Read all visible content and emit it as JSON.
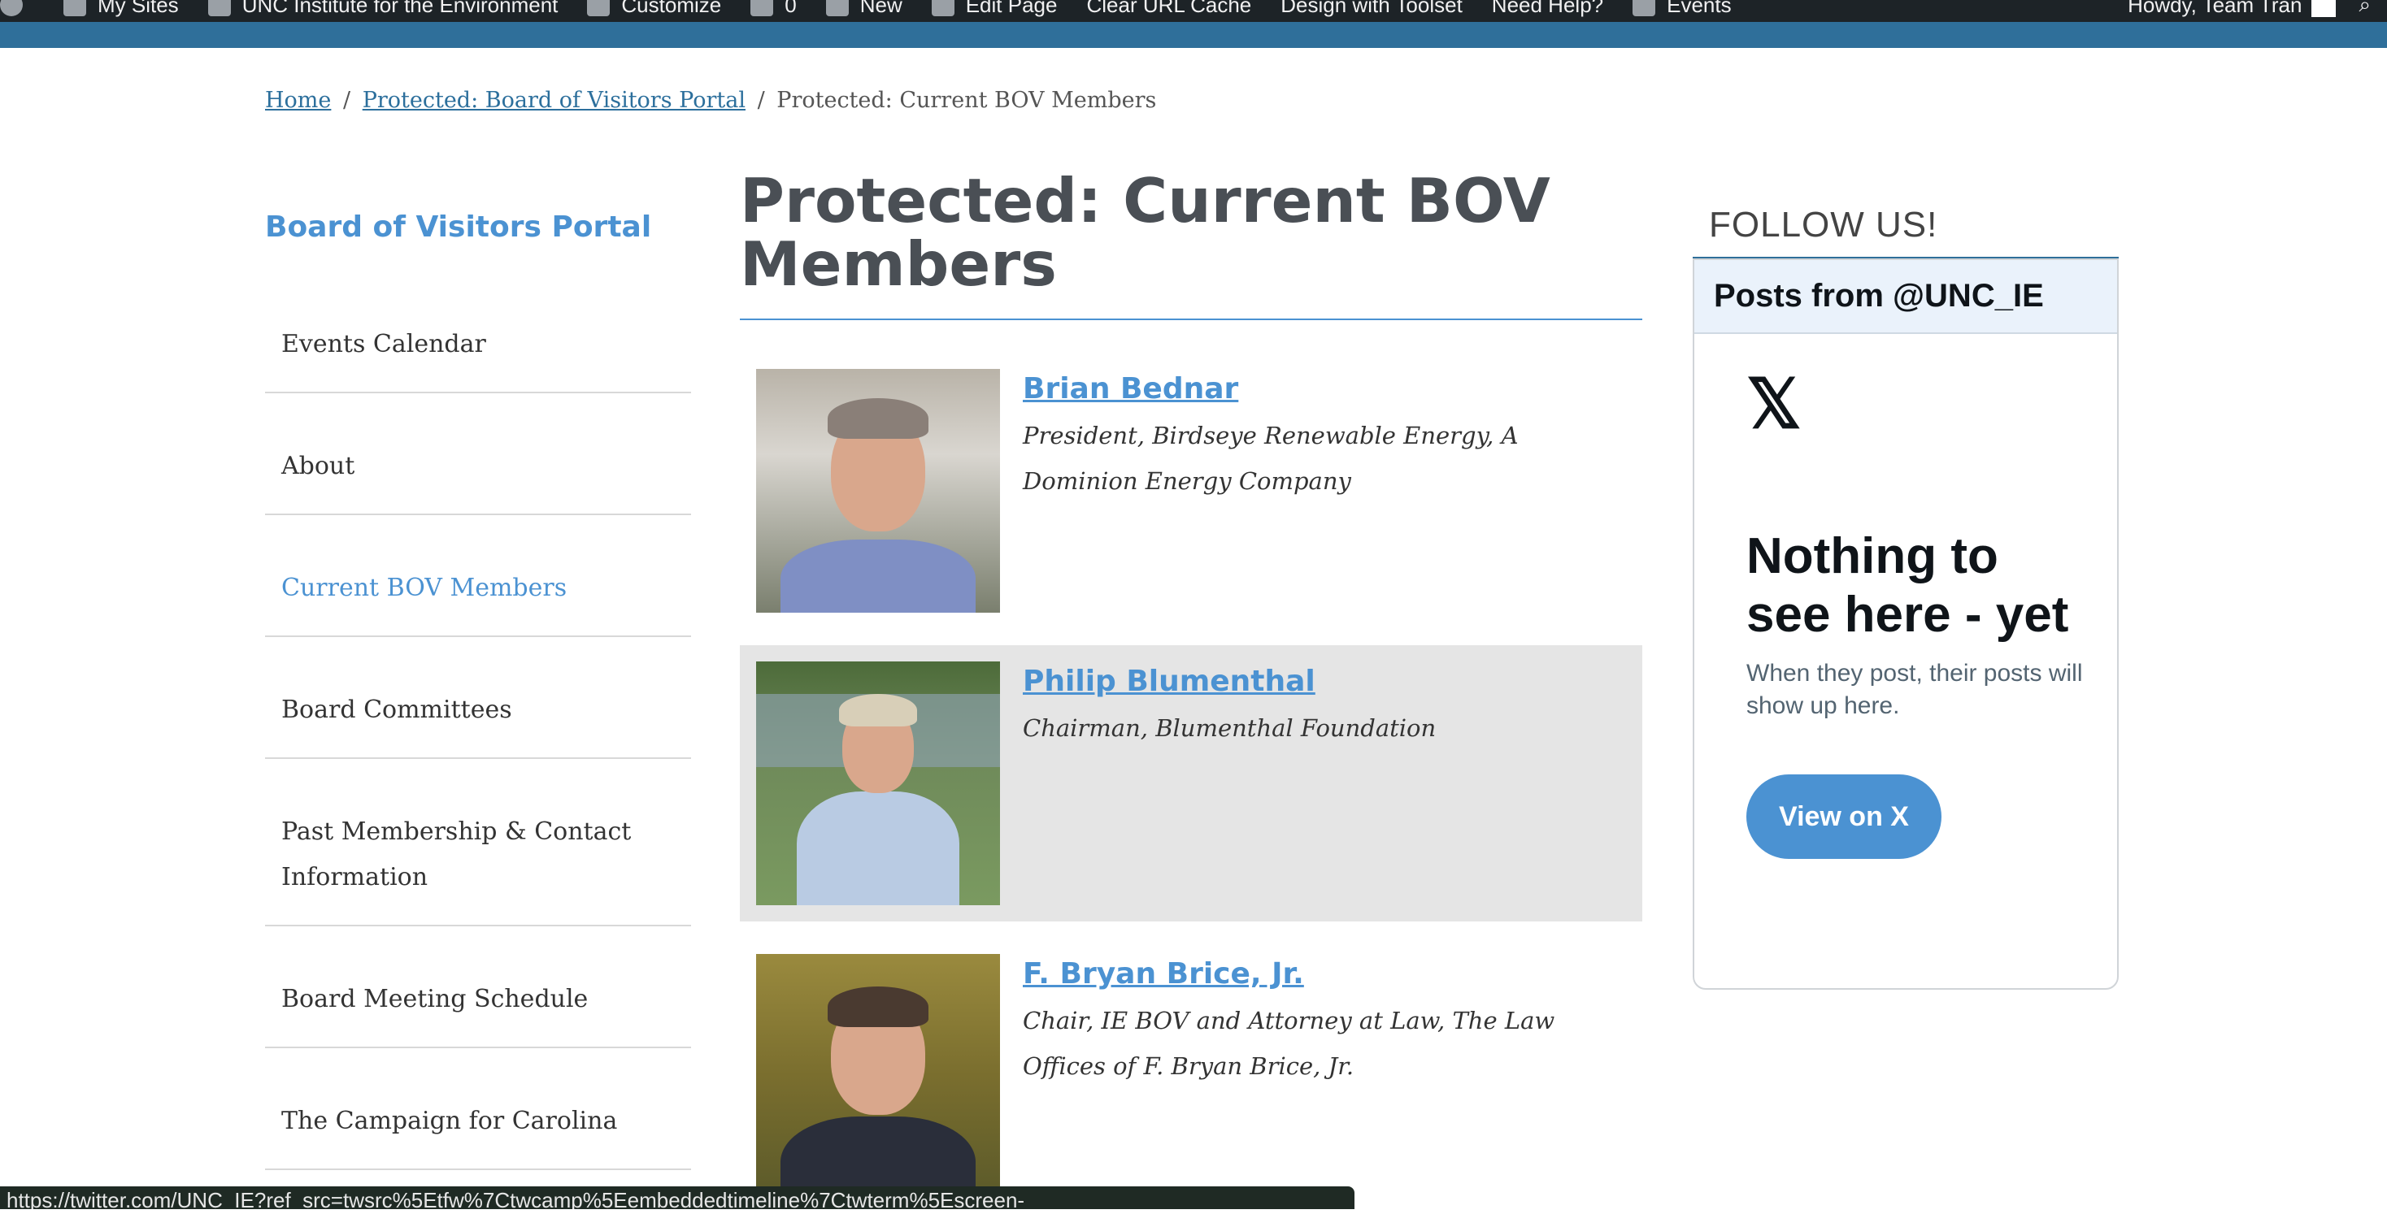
{
  "adminbar": {
    "items": [
      "My Sites",
      "UNC Institute for the Environment",
      "Customize",
      "0",
      "New",
      "Edit Page",
      "Clear URL Cache",
      "Design with Toolset",
      "Need Help?",
      "Events"
    ],
    "greeting": "Howdy, Team Tran"
  },
  "breadcrumb": {
    "home": "Home",
    "parent": "Protected: Board of Visitors Portal",
    "current": "Protected: Current BOV Members",
    "separator": "/"
  },
  "sidebar": {
    "title": "Board of Visitors Portal",
    "items": [
      {
        "label": "Events Calendar"
      },
      {
        "label": "About"
      },
      {
        "label": "Current BOV Members"
      },
      {
        "label": "Board Committees"
      },
      {
        "label": "Past Membership & Contact Information"
      },
      {
        "label": "Board Meeting Schedule"
      },
      {
        "label": "The Campaign for Carolina"
      }
    ],
    "active_index": 2
  },
  "main": {
    "title": "Protected: Current BOV Members",
    "members": [
      {
        "name": "Brian Bednar",
        "role": "President, Birdseye Renewable Energy, A Dominion Energy Company"
      },
      {
        "name": "Philip Blumenthal",
        "role": "Chairman, Blumenthal Foundation"
      },
      {
        "name": "F. Bryan Brice, Jr.",
        "role": "Chair, IE BOV and Attorney at Law, The Law Offices of F. Bryan Brice, Jr."
      }
    ]
  },
  "follow": {
    "heading": "FOLLOW US!",
    "widget_header": "Posts from @UNC_IE",
    "x_logo": "𝕏",
    "empty_title": "Nothing to see here - yet",
    "empty_sub": "When they post, their posts will show up here.",
    "button": "View on X"
  },
  "statusbar": {
    "url": "https://twitter.com/UNC_IE?ref_src=twsrc%5Etfw%7Ctwcamp%5Eembeddedtimeline%7Ctwterm%5Escreen-name%3AUNC_IE%7Ctwcon%5Es2"
  },
  "colors": {
    "accent": "#4b92d2",
    "link": "#2c6f9c",
    "adminbar": "#1d2327",
    "bluebar": "#2f6f9a",
    "alt_row": "#e5e5e5"
  }
}
